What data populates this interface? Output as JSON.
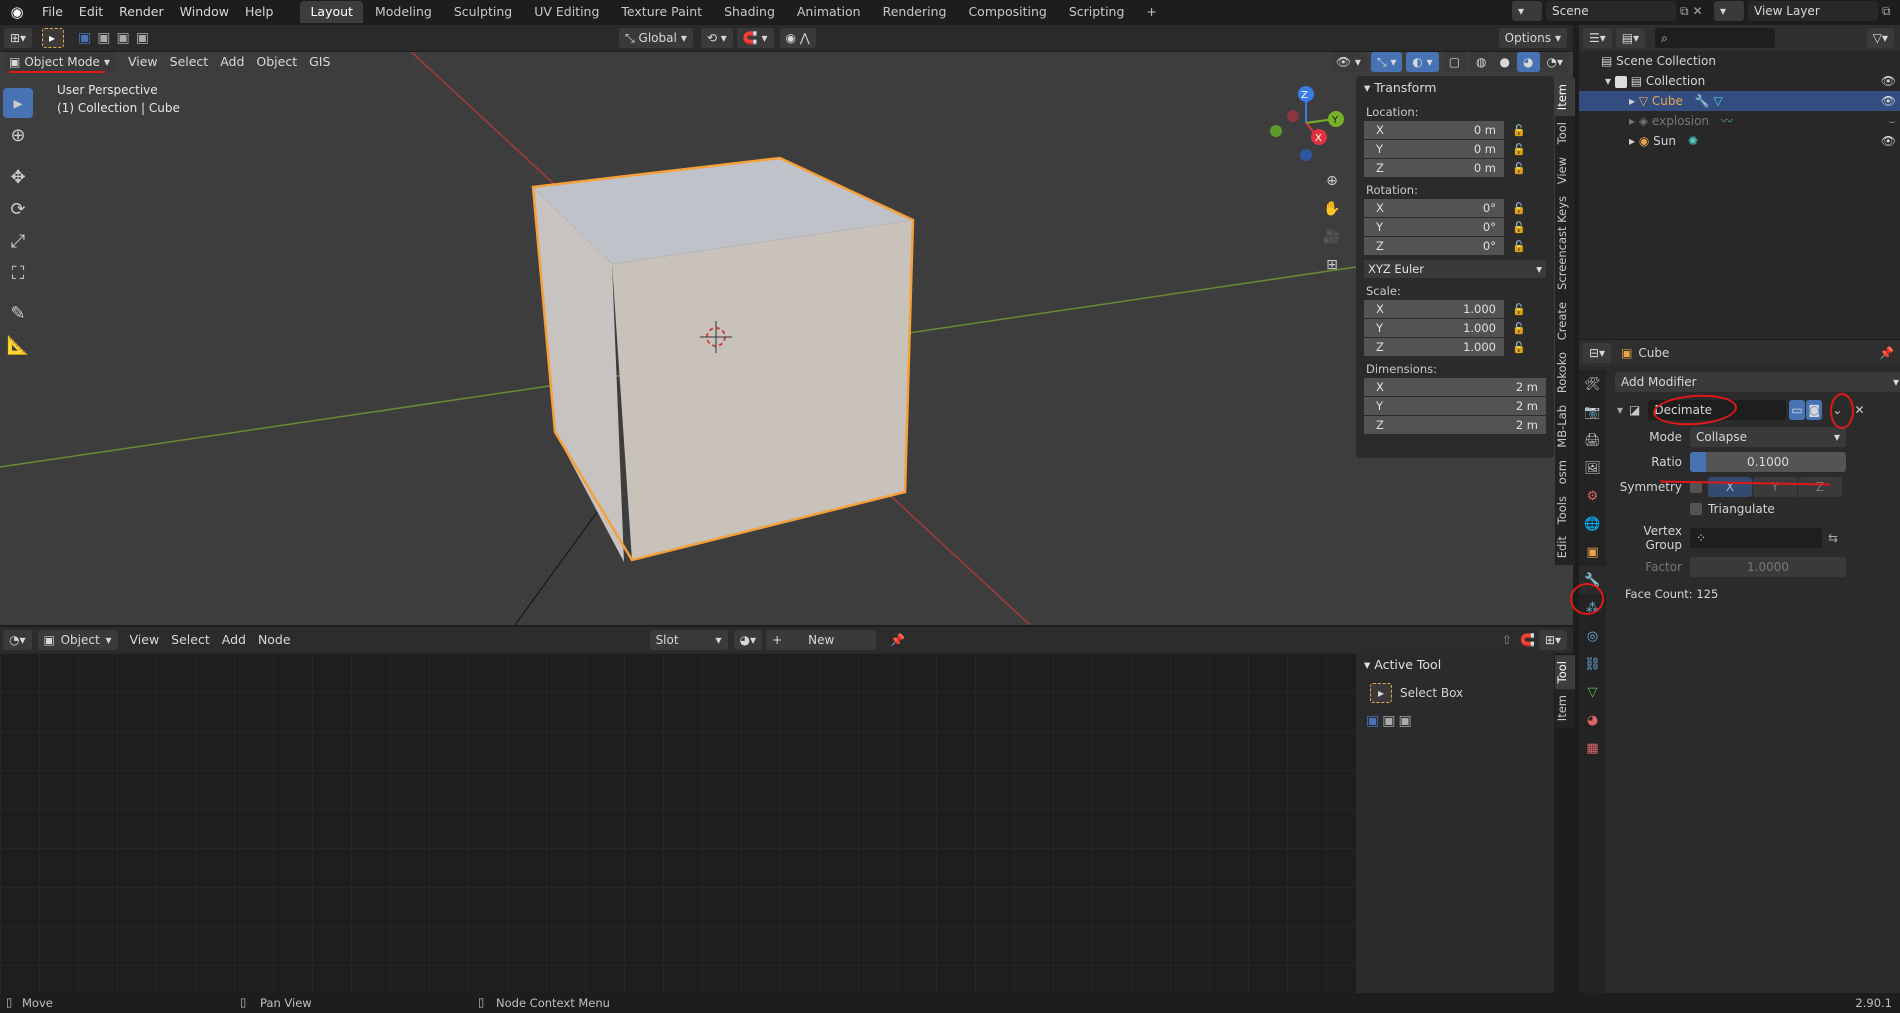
{
  "topbar": {
    "menus": [
      "File",
      "Edit",
      "Render",
      "Window",
      "Help"
    ],
    "workspaces": [
      "Layout",
      "Modeling",
      "Sculpting",
      "UV Editing",
      "Texture Paint",
      "Shading",
      "Animation",
      "Rendering",
      "Compositing",
      "Scripting"
    ],
    "add_tab": "+",
    "scene": "Scene",
    "view_layer": "View Layer"
  },
  "tool_header": {
    "orientation": "Global",
    "options": "Options"
  },
  "viewport_header": {
    "mode": "Object Mode",
    "menus": [
      "View",
      "Select",
      "Add",
      "Object",
      "GIS"
    ]
  },
  "viewport": {
    "perspective": "User Perspective",
    "collection_info": "(1) Collection | Cube",
    "gizmo": {
      "x": "X",
      "y": "Y",
      "z": "Z"
    }
  },
  "npanel": {
    "title": "Transform",
    "location_label": "Location:",
    "location": [
      {
        "axis": "X",
        "value": "0 m"
      },
      {
        "axis": "Y",
        "value": "0 m"
      },
      {
        "axis": "Z",
        "value": "0 m"
      }
    ],
    "rotation_label": "Rotation:",
    "rotation": [
      {
        "axis": "X",
        "value": "0°"
      },
      {
        "axis": "Y",
        "value": "0°"
      },
      {
        "axis": "Z",
        "value": "0°"
      }
    ],
    "rotation_mode": "XYZ Euler",
    "scale_label": "Scale:",
    "scale": [
      {
        "axis": "X",
        "value": "1.000"
      },
      {
        "axis": "Y",
        "value": "1.000"
      },
      {
        "axis": "Z",
        "value": "1.000"
      }
    ],
    "dimensions_label": "Dimensions:",
    "dimensions": [
      {
        "axis": "X",
        "value": "2 m"
      },
      {
        "axis": "Y",
        "value": "2 m"
      },
      {
        "axis": "Z",
        "value": "2 m"
      }
    ],
    "tabs": [
      "Item",
      "Tool",
      "View",
      "Screencast Keys",
      "Create",
      "Rokoko",
      "MB-Lab",
      "osm",
      "Tools",
      "Edit"
    ]
  },
  "outliner": {
    "root": "Scene Collection",
    "collection": "Collection",
    "items": [
      {
        "name": "Cube",
        "color": "#e8a64a"
      },
      {
        "name": "explosion",
        "color": "#8a8a8a"
      },
      {
        "name": "Sun",
        "color": "#d4d4d4"
      }
    ]
  },
  "properties": {
    "object_name": "Cube",
    "add_modifier": "Add Modifier",
    "modifier_name": "Decimate",
    "mode_label": "Mode",
    "mode_value": "Collapse",
    "ratio_label": "Ratio",
    "ratio_value": "0.1000",
    "ratio_fraction": 0.1,
    "symmetry_label": "Symmetry",
    "symmetry_axes": [
      "X",
      "Y",
      "Z"
    ],
    "triangulate_label": "Triangulate",
    "vertex_group_label": "Vertex Group",
    "factor_label": "Factor",
    "factor_value": "1.0000",
    "face_count": "Face Count: 125"
  },
  "node_header": {
    "type": "Object",
    "menus": [
      "View",
      "Select",
      "Add",
      "Node"
    ],
    "slot": "Slot",
    "new_label": "New"
  },
  "node_sidebar": {
    "title": "Active Tool",
    "tool_name": "Select Box",
    "tabs": [
      "Tool",
      "Item"
    ]
  },
  "statusbar": {
    "move": "Move",
    "pan": "Pan View",
    "context": "Node Context Menu",
    "version": "2.90.1"
  },
  "colors": {
    "accent_blue": "#4772b3",
    "selection_orange": "#f5a03a",
    "annotation_red": "#e01818"
  }
}
